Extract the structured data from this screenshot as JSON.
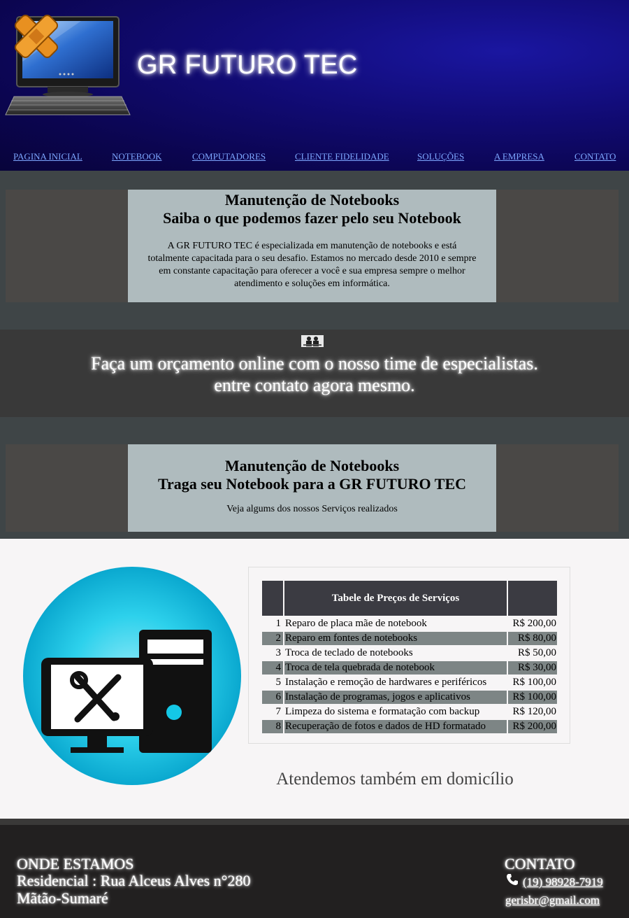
{
  "header": {
    "site_title": "GR FUTURO TEC",
    "nav": [
      {
        "label": "PAGINA INICIAL"
      },
      {
        "label": "NOTEBOOK"
      },
      {
        "label": "COMPUTADORES"
      },
      {
        "label": "CLIENTE FIDELIDADE"
      },
      {
        "label": "SOLUÇÕES"
      },
      {
        "label": "A EMPRESA"
      },
      {
        "label": "CONTATO"
      }
    ]
  },
  "intro": {
    "title_line1": "Manutenção de Notebooks",
    "title_line2": "Saiba o que podemos fazer pelo seu Notebook",
    "body_lines": [
      "A GR FUTURO TEC é especializada em manutenção de notebooks e está",
      "totalmente capacitada para o seu desafio. Estamos no mercado desde 2010 e sempre",
      "em constante capacitação para oferecer a você e sua empresa sempre o melhor",
      "atendimento e soluções em informática."
    ]
  },
  "cta": {
    "line1": "Faça um orçamento online com o nosso time de especialistas.",
    "line2": "entre contato agora mesmo.",
    "icon": "people-icon"
  },
  "services": {
    "title_line1": "Manutenção de Notebooks",
    "title_line2": "Traga seu Notebook para a GR FUTURO TEC",
    "subtitle": "Veja algums dos nossos Serviços realizados"
  },
  "price_table": {
    "header": "Tabele de Preços de Serviços",
    "rows": [
      {
        "n": "1",
        "service": "Reparo de placa mãe de notebook",
        "price": "R$ 200,00"
      },
      {
        "n": "2",
        "service": "Reparo em fontes de notebooks",
        "price": "R$ 80,00"
      },
      {
        "n": "3",
        "service": "Troca de teclado de notebooks",
        "price": "R$ 50,00"
      },
      {
        "n": "4",
        "service": "Troca de tela quebrada de notebook",
        "price": "R$ 30,00"
      },
      {
        "n": "5",
        "service": "Instalação e remoção de hardwares e periféricos",
        "price": "R$ 100,00"
      },
      {
        "n": "6",
        "service": "Instalação de programas, jogos e aplicativos",
        "price": "R$ 100,00"
      },
      {
        "n": "7",
        "service": "Limpeza do sistema e formatação com backup",
        "price": "R$ 120,00"
      },
      {
        "n": "8",
        "service": "Recuperação de fotos e dados de HD formatado",
        "price": "R$ 200,00"
      }
    ]
  },
  "domicilio": "Atendemos também em domicílio",
  "footer": {
    "location_title": "ONDE ESTAMOS",
    "address_line1": "Residencial : Rua Alceus Alves n°280",
    "address_line2": "Mãtão-Sumaré",
    "contact_title": "CONTATO",
    "phone": "(19) 98928-7919",
    "email": "gerisbr@gmail.com"
  },
  "colors": {
    "header_bg": "#110b75",
    "nav_link": "#7da7ff",
    "panel_light": "#afbbbe",
    "table_header": "#3b3b42",
    "circle_accent": "#14c8e6"
  }
}
